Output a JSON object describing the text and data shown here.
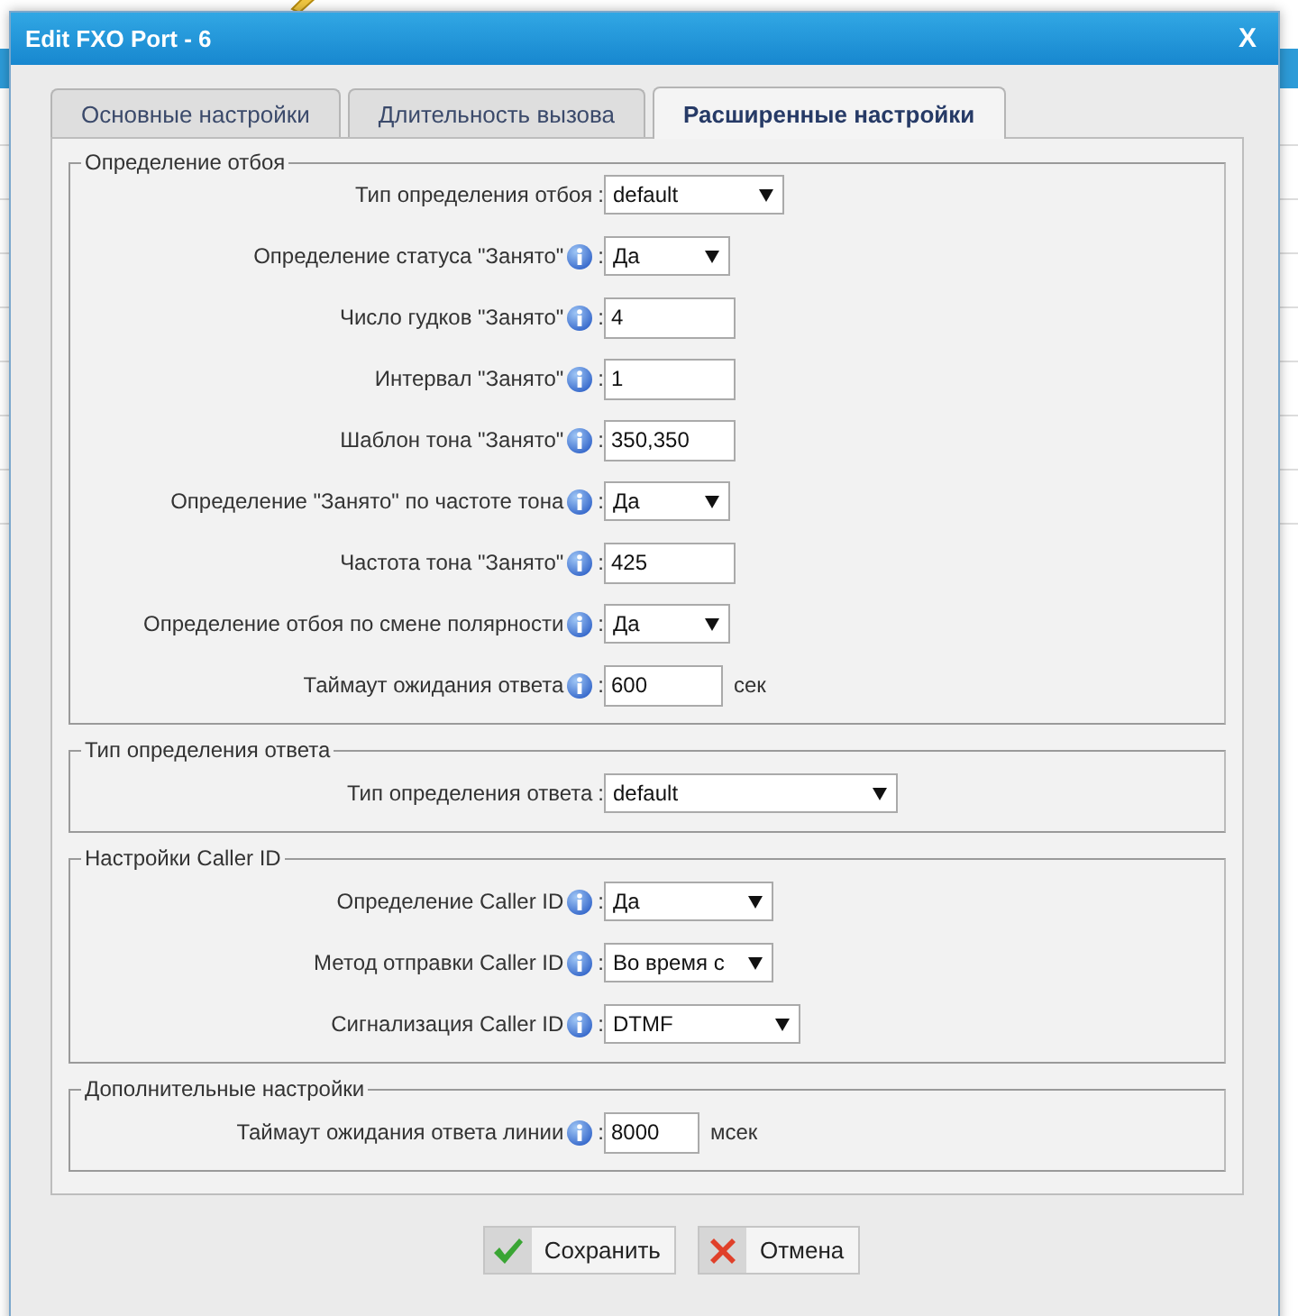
{
  "window": {
    "title": "Edit FXO Port - 6",
    "close": "X"
  },
  "tabs": [
    {
      "label": "Основные настройки",
      "selected": false
    },
    {
      "label": "Длительность вызова",
      "selected": false
    },
    {
      "label": "Расширенные настройки",
      "selected": true
    }
  ],
  "sections": [
    {
      "title": "Определение отбоя",
      "rows": [
        {
          "label": "Тип определения отбоя",
          "info": false,
          "colon": ":",
          "kind": "select",
          "value": "default"
        },
        {
          "label": "Определение статуса \"Занято\"",
          "info": true,
          "colon": ":",
          "kind": "select",
          "value": "Да"
        },
        {
          "label": "Число гудков \"Занято\"",
          "info": true,
          "colon": ":",
          "kind": "input",
          "value": "4"
        },
        {
          "label": "Интервал \"Занято\"",
          "info": true,
          "colon": ":",
          "kind": "input",
          "value": "1"
        },
        {
          "label": "Шаблон тона \"Занято\"",
          "info": true,
          "colon": ":",
          "kind": "input",
          "value": "350,350"
        },
        {
          "label": "Определение \"Занято\" по частоте тона",
          "info": true,
          "colon": ":",
          "kind": "select",
          "value": "Да"
        },
        {
          "label": "Частота тона \"Занято\"",
          "info": true,
          "colon": ":",
          "kind": "input",
          "value": "425"
        },
        {
          "label": "Определение отбоя по смене полярности",
          "info": true,
          "colon": ":",
          "kind": "select",
          "value": "Да"
        },
        {
          "label": "Таймаут ожидания ответа",
          "info": true,
          "colon": ":",
          "kind": "input",
          "value": "600",
          "unit": "сек"
        }
      ]
    },
    {
      "title": "Тип определения ответа",
      "rows": [
        {
          "label": "Тип определения ответа",
          "info": false,
          "colon": ":",
          "kind": "select",
          "value": "default"
        }
      ]
    },
    {
      "title": "Настройки Caller ID",
      "rows": [
        {
          "label": "Определение Caller ID",
          "info": true,
          "colon": ":",
          "kind": "select",
          "value": "Да"
        },
        {
          "label": "Метод отправки Caller ID",
          "info": true,
          "colon": ":",
          "kind": "select",
          "value": "Во время с"
        },
        {
          "label": "Сигнализация Caller ID",
          "info": true,
          "colon": ":",
          "kind": "select",
          "value": "DTMF"
        }
      ]
    },
    {
      "title": "Дополнительные настройки",
      "rows": [
        {
          "label": "Таймаут ожидания ответа линии",
          "info": true,
          "colon": ":",
          "kind": "input",
          "value": "8000",
          "unit": "мсек"
        }
      ]
    }
  ],
  "buttons": [
    {
      "label": "Сохранить",
      "kind": "save"
    },
    {
      "label": "Отмена",
      "kind": "cancel"
    }
  ]
}
